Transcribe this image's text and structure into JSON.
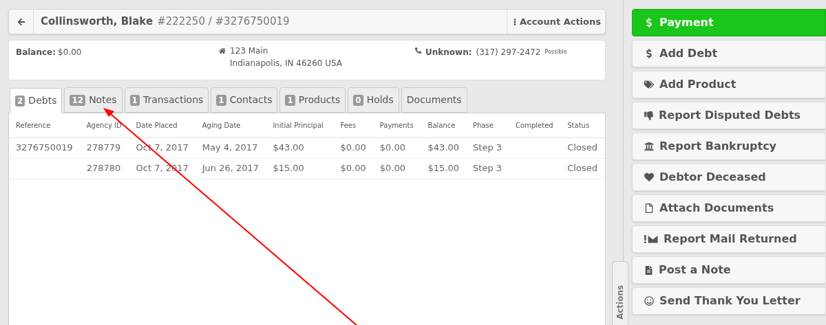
{
  "header": {
    "name": "Collinsworth, Blake",
    "numbers": "#222250 / #3276750019",
    "actions_label": "Account Actions"
  },
  "info": {
    "balance_label": "Balance:",
    "balance_value": "$0.00",
    "address": [
      "123 Main",
      "Indianapolis, IN 46260 USA"
    ],
    "phone_label": "Unknown:",
    "phone": "(317) 297-2472",
    "phone_note": "Possible"
  },
  "tabs": [
    {
      "count": "2",
      "label": "Debts",
      "selected": true
    },
    {
      "count": "12",
      "label": "Notes",
      "selected": false
    },
    {
      "count": "1",
      "label": "Transactions",
      "selected": false
    },
    {
      "count": "1",
      "label": "Contacts",
      "selected": false
    },
    {
      "count": "1",
      "label": "Products",
      "selected": false
    },
    {
      "count": "0",
      "label": "Holds",
      "selected": false
    },
    {
      "label": "Documents",
      "selected": false
    }
  ],
  "table": {
    "columns": [
      "Reference",
      "Agency ID",
      "Date Placed",
      "Aging Date",
      "Initial Principal",
      "Fees",
      "Payments",
      "Balance",
      "Phase",
      "Completed",
      "Status"
    ],
    "rows": [
      [
        "3276750019",
        "278779",
        "Oct 7, 2017",
        "May 4, 2017",
        "$43.00",
        "$0.00",
        "$0.00",
        "$43.00",
        "Step 3",
        "",
        "Closed"
      ],
      [
        "",
        "278780",
        "Oct 7, 2017",
        "Jun 26, 2017",
        "$15.00",
        "$0.00",
        "$0.00",
        "$15.00",
        "Step 3",
        "",
        "Closed"
      ]
    ]
  },
  "side_tab": "Actions",
  "actions": [
    {
      "kind": "dollar",
      "label": "Payment",
      "highlighted": true
    },
    {
      "kind": "dollar",
      "label": "Add Debt",
      "highlighted": false
    },
    {
      "kind": "tags",
      "label": "Add Product",
      "highlighted": false
    },
    {
      "kind": "thumbs-down",
      "label": "Report Disputed Debts",
      "highlighted": false
    },
    {
      "kind": "bank",
      "label": "Report Bankruptcy",
      "highlighted": false
    },
    {
      "kind": "heart",
      "label": "Debtor Deceased",
      "highlighted": false
    },
    {
      "kind": "file",
      "label": "Attach Documents",
      "highlighted": false
    },
    {
      "kind": "mail-alert",
      "label": "Report Mail Returned",
      "highlighted": false
    },
    {
      "kind": "note",
      "label": "Post a Note",
      "highlighted": false
    },
    {
      "kind": "smile",
      "label": "Send Thank You Letter",
      "highlighted": false
    }
  ]
}
